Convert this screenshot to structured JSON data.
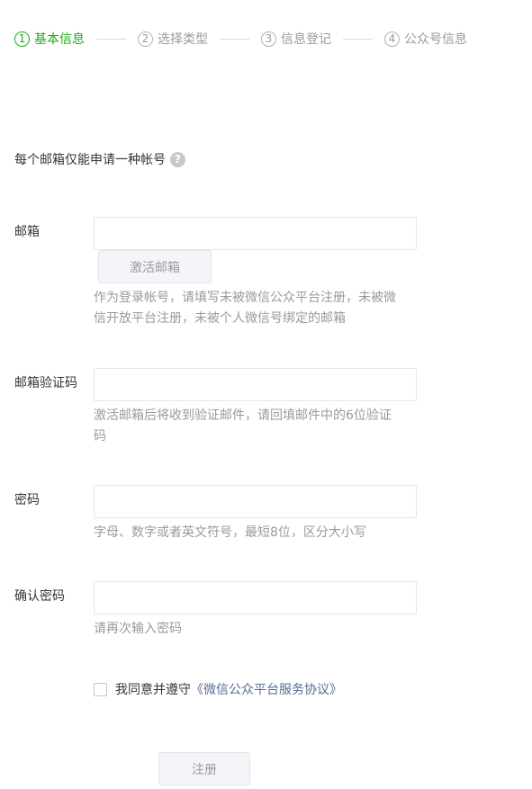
{
  "steps": [
    {
      "num": "1",
      "label": "基本信息"
    },
    {
      "num": "2",
      "label": "选择类型"
    },
    {
      "num": "3",
      "label": "信息登记"
    },
    {
      "num": "4",
      "label": "公众号信息"
    }
  ],
  "notice": {
    "text": "每个邮箱仅能申请一种帐号",
    "help_icon": "?"
  },
  "form": {
    "email": {
      "label": "邮箱",
      "value": "",
      "activate_button": "激活邮箱",
      "tip": "作为登录帐号，请填写未被微信公众平台注册，未被微信开放平台注册，未被个人微信号绑定的邮箱"
    },
    "code": {
      "label": "邮箱验证码",
      "value": "",
      "tip": "激活邮箱后将收到验证邮件，请回填邮件中的6位验证码"
    },
    "password": {
      "label": "密码",
      "value": "",
      "tip": "字母、数字或者英文符号，最短8位，区分大小写"
    },
    "confirm": {
      "label": "确认密码",
      "value": "",
      "tip": "请再次输入密码"
    },
    "agree": {
      "checked": false,
      "text": "我同意并遵守",
      "link": "《微信公众平台服务协议》"
    },
    "submit_label": "注册"
  },
  "colors": {
    "accent": "#1aad19",
    "link": "#576b95",
    "muted": "#9a9a9a",
    "text": "#353535"
  }
}
